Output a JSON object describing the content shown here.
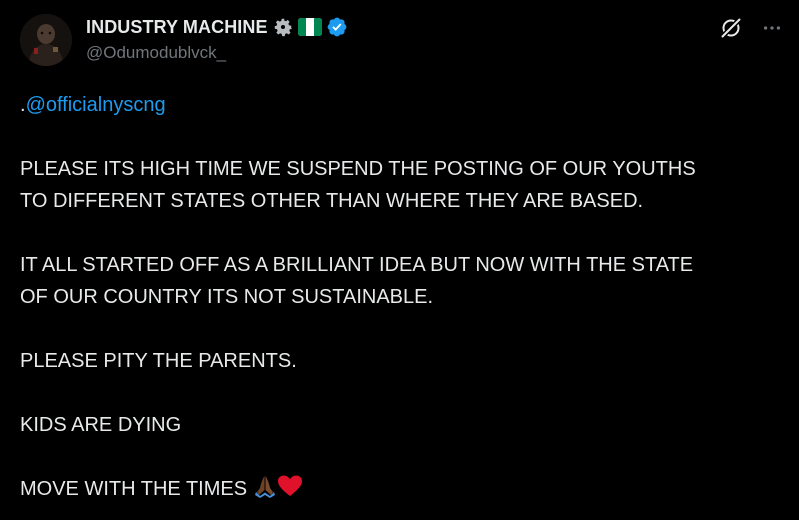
{
  "author": {
    "display_name": "INDUSTRY MACHINE",
    "handle": "@Odumodublvck_",
    "badges": [
      "gear-icon",
      "nigeria-flag-icon",
      "verified-badge-icon"
    ]
  },
  "actions": {
    "grok_icon": "grok-icon",
    "more_icon": "more-options-icon"
  },
  "post": {
    "mention_prefix": ".",
    "mention": "@officialnyscng",
    "p1_line1": "PLEASE ITS HIGH TIME WE SUSPEND THE POSTING OF OUR YOUTHS",
    "p1_line2": "TO DIFFERENT STATES OTHER THAN WHERE THEY ARE BASED.",
    "p2_line1": "IT ALL STARTED OFF AS A BRILLIANT IDEA BUT NOW WITH THE STATE",
    "p2_line2": "OF OUR COUNTRY ITS NOT SUSTAINABLE.",
    "p3": "PLEASE PITY THE PARENTS.",
    "p4": "KIDS ARE DYING",
    "p5": "MOVE WITH THE TIMES"
  },
  "colors": {
    "background": "#000000",
    "text": "#e7e9ea",
    "muted": "#71767b",
    "link": "#1d9bf0",
    "verified": "#1d9bf0",
    "flag_green": "#008751",
    "heart": "#e0112b"
  }
}
